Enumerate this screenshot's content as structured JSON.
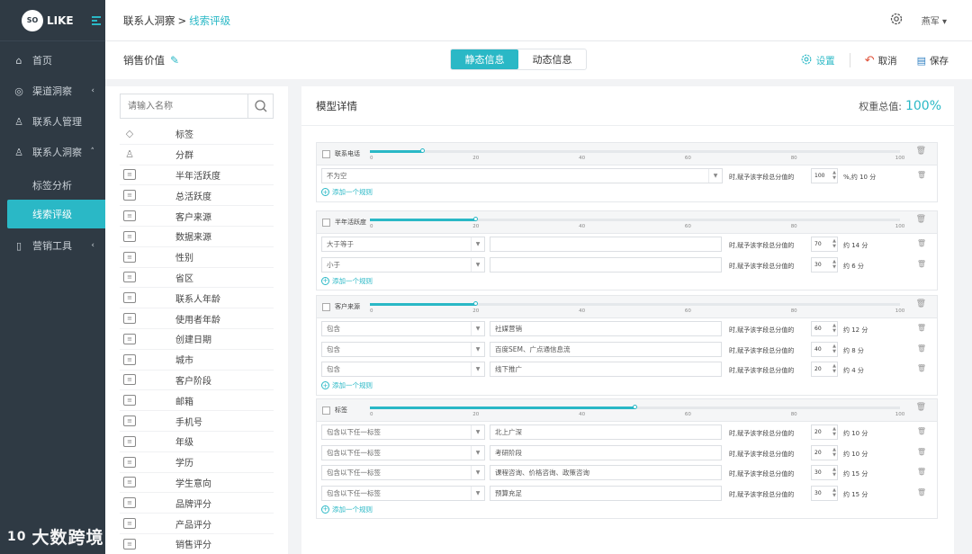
{
  "logo": {
    "badge": "SO",
    "text": "LIKE"
  },
  "sidebar": {
    "items": [
      {
        "label": "首页",
        "icon": "home-icon",
        "arrow": ""
      },
      {
        "label": "渠道洞察",
        "icon": "channel-icon",
        "arrow": "‹"
      },
      {
        "label": "联系人管理",
        "icon": "contact-icon",
        "arrow": ""
      },
      {
        "label": "联系人洞察",
        "icon": "insight-icon",
        "arrow": "˄"
      }
    ],
    "subitems": [
      {
        "label": "标签分析"
      },
      {
        "label": "线索评级"
      }
    ],
    "marketing": {
      "label": "营销工具",
      "arrow": "‹"
    }
  },
  "breadcrumb": {
    "parent": "联系人洞察",
    "sep": ">",
    "current": "线索评级"
  },
  "user": {
    "name": "燕军"
  },
  "toolbar": {
    "title": "销售价值",
    "tabs": [
      "静态信息",
      "动态信息"
    ],
    "settings": "设置",
    "cancel": "取消",
    "save": "保存"
  },
  "search": {
    "placeholder": "请输入名称"
  },
  "fields": [
    "标签",
    "分群",
    "半年活跃度",
    "总活跃度",
    "客户来源",
    "数据来源",
    "性别",
    "省区",
    "联系人年龄",
    "使用者年龄",
    "创建日期",
    "城市",
    "客户阶段",
    "邮箱",
    "手机号",
    "年级",
    "学历",
    "学生意向",
    "品牌评分",
    "产品评分",
    "销售评分"
  ],
  "main": {
    "title": "模型详情",
    "weight_label": "权重总值:",
    "weight_value": "100%"
  },
  "ticks": [
    "0",
    "20",
    "40",
    "60",
    "80",
    "100"
  ],
  "add_rule": "添加一个规则",
  "assign_text": "时,赋予该字段总分值的",
  "blocks": [
    {
      "name": "联系电话",
      "weight": 10,
      "rules": [
        {
          "op": "不为空",
          "value": "",
          "pct": "100",
          "unit": "%,约 10 分",
          "wide": true
        }
      ]
    },
    {
      "name": "半年活跃度",
      "weight": 20,
      "rules": [
        {
          "op": "大于等于",
          "value": "",
          "pct": "70",
          "unit": "约 14 分"
        },
        {
          "op": "小于",
          "value": "",
          "pct": "30",
          "unit": "约 6 分"
        }
      ]
    },
    {
      "name": "客户来源",
      "weight": 20,
      "rules": [
        {
          "op": "包含",
          "value": "社媒营销",
          "pct": "60",
          "unit": "约 12 分"
        },
        {
          "op": "包含",
          "value": "百度SEM、广点通信息流",
          "pct": "40",
          "unit": "约 8 分"
        },
        {
          "op": "包含",
          "value": "线下推广",
          "pct": "20",
          "unit": "约 4 分"
        }
      ]
    },
    {
      "name": "标签",
      "weight": 50,
      "rules": [
        {
          "op": "包含以下任一标签",
          "value": "北上广深",
          "pct": "20",
          "unit": "约 10 分"
        },
        {
          "op": "包含以下任一标签",
          "value": "考研阶段",
          "pct": "20",
          "unit": "约 10 分"
        },
        {
          "op": "包含以下任一标签",
          "value": "课程咨询、价格咨询、政策咨询",
          "pct": "30",
          "unit": "约 15 分"
        },
        {
          "op": "包含以下任一标签",
          "value": "预算充足",
          "pct": "30",
          "unit": "约 15 分"
        }
      ]
    }
  ],
  "watermark": {
    "logo": "10",
    "text": "大数跨境"
  }
}
